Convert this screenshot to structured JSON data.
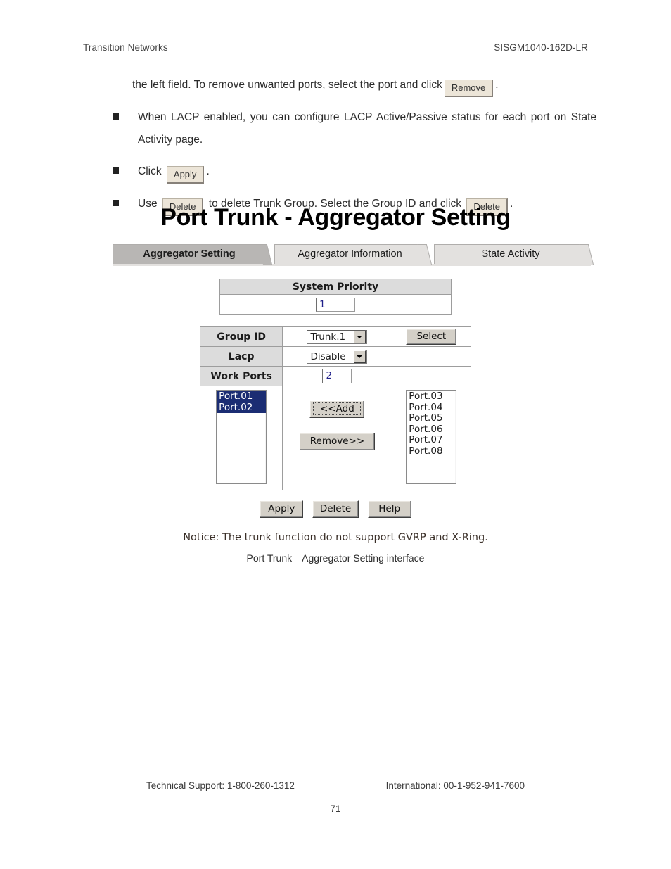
{
  "header": {
    "company": "Transition Networks",
    "model": "SISGM1040-162D-LR"
  },
  "body": {
    "lead_before": "the left field. To remove unwanted ports, select the port and click",
    "lead_btn": "Remove",
    "lead_after": ".",
    "bullets": [
      {
        "text": "When LACP enabled, you can configure LACP Active/Passive status for each port on State Activity page."
      },
      {
        "before": "Click",
        "btn": "Apply",
        "after": "."
      },
      {
        "before": "Use",
        "btn1": "Delete",
        "middle": "to delete Trunk Group. Select the Group ID and click",
        "btn2": "Delete",
        "after": "."
      }
    ]
  },
  "screenshot": {
    "title": "Port Trunk - Aggregator Setting",
    "tabs": [
      {
        "label": "Aggregator Setting",
        "active": true
      },
      {
        "label": "Aggregator Information",
        "active": false
      },
      {
        "label": "State Activity",
        "active": false
      }
    ],
    "system_priority": {
      "header": "System Priority",
      "value": "1"
    },
    "config": {
      "group_id_label": "Group ID",
      "group_id_value": "Trunk.1",
      "select_button": "Select",
      "lacp_label": "Lacp",
      "lacp_value": "Disable",
      "work_ports_label": "Work Ports",
      "work_ports_value": "2"
    },
    "port_lists": {
      "member_ports": [
        {
          "label": "Port.01",
          "selected": true
        },
        {
          "label": "Port.02",
          "selected": true
        }
      ],
      "available_ports": [
        {
          "label": "Port.03",
          "selected": false
        },
        {
          "label": "Port.04",
          "selected": false
        },
        {
          "label": "Port.05",
          "selected": false
        },
        {
          "label": "Port.06",
          "selected": false
        },
        {
          "label": "Port.07",
          "selected": false
        },
        {
          "label": "Port.08",
          "selected": false
        }
      ],
      "add_button": "<<Add",
      "remove_button": "Remove>>"
    },
    "actions": [
      {
        "label": "Apply"
      },
      {
        "label": "Delete"
      },
      {
        "label": "Help"
      }
    ],
    "notice": "Notice: The trunk function do not support GVRP and X-Ring.",
    "caption": "Port Trunk—Aggregator Setting interface"
  },
  "footer": {
    "tech_support": "Technical Support: 1-800-260-1312",
    "international": "International: 00-1-952-941-7600",
    "page_number": "71"
  },
  "colors": {
    "selection_blue": "#1b2d73",
    "tab_active": "#b8b6b4",
    "tab_inactive": "#e3e1df",
    "table_header": "#dcdcdc",
    "button_face": "#d4d0c8",
    "inline_button": "#ece5d8"
  }
}
